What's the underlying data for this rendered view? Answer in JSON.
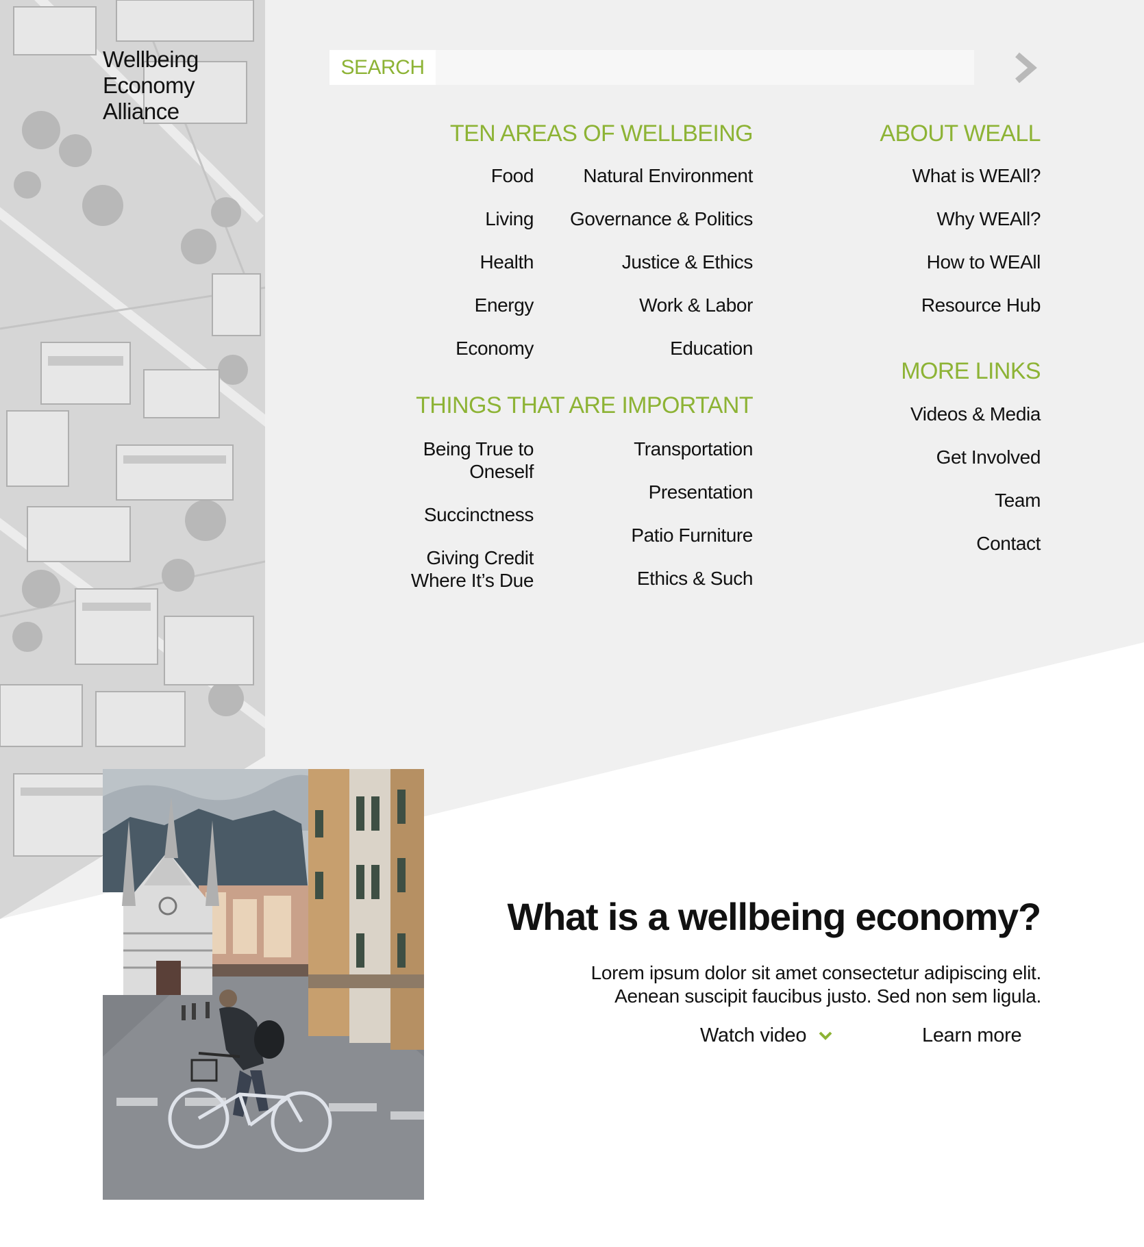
{
  "brand": {
    "logo_lines": [
      "Wellbeing",
      "Economy",
      "Alliance"
    ]
  },
  "search": {
    "label": "SEARCH",
    "placeholder": "",
    "value": "",
    "submit_icon": "chevron-right-icon"
  },
  "menu": {
    "ten_areas": {
      "heading": "TEN AREAS OF WELLBEING",
      "col_left": [
        "Food",
        "Living",
        "Health",
        "Energy",
        "Economy"
      ],
      "col_right": [
        "Natural Environment",
        "Governance & Politics",
        "Justice & Ethics",
        "Work & Labor",
        "Education"
      ]
    },
    "important": {
      "heading": "THINGS THAT ARE IMPORTANT",
      "col_left": [
        "Being True to Oneself",
        "Succinctness",
        "Giving Credit Where It’s Due"
      ],
      "col_right": [
        "Transportation",
        "Presentation",
        "Patio Furniture",
        "Ethics & Such"
      ]
    },
    "about": {
      "heading": "ABOUT WEALL",
      "items": [
        "What is WEAll?",
        "Why WEAll?",
        "How to WEAll",
        "Resource Hub"
      ]
    },
    "more_links": {
      "heading": "MORE LINKS",
      "items": [
        "Videos & Media",
        "Get Involved",
        "Team",
        "Contact"
      ]
    }
  },
  "hero": {
    "title": "What is a wellbeing economy?",
    "body_lines": [
      "Lorem ipsum dolor sit amet consectetur adipiscing elit.",
      "Aenean suscipit faucibus justo. Sed non sem ligula."
    ],
    "watch_video_label": "Watch video",
    "watch_video_icon": "chevron-down-icon",
    "learn_more_label": "Learn more"
  },
  "colors": {
    "accent": "#8db335",
    "panel_grey": "#f0f0f0",
    "text": "#111111",
    "search_field": "#f7f7f7"
  },
  "images": {
    "aerial": "grayscale aerial city photo",
    "street": "cyclist walking bicycle on street beside church"
  }
}
